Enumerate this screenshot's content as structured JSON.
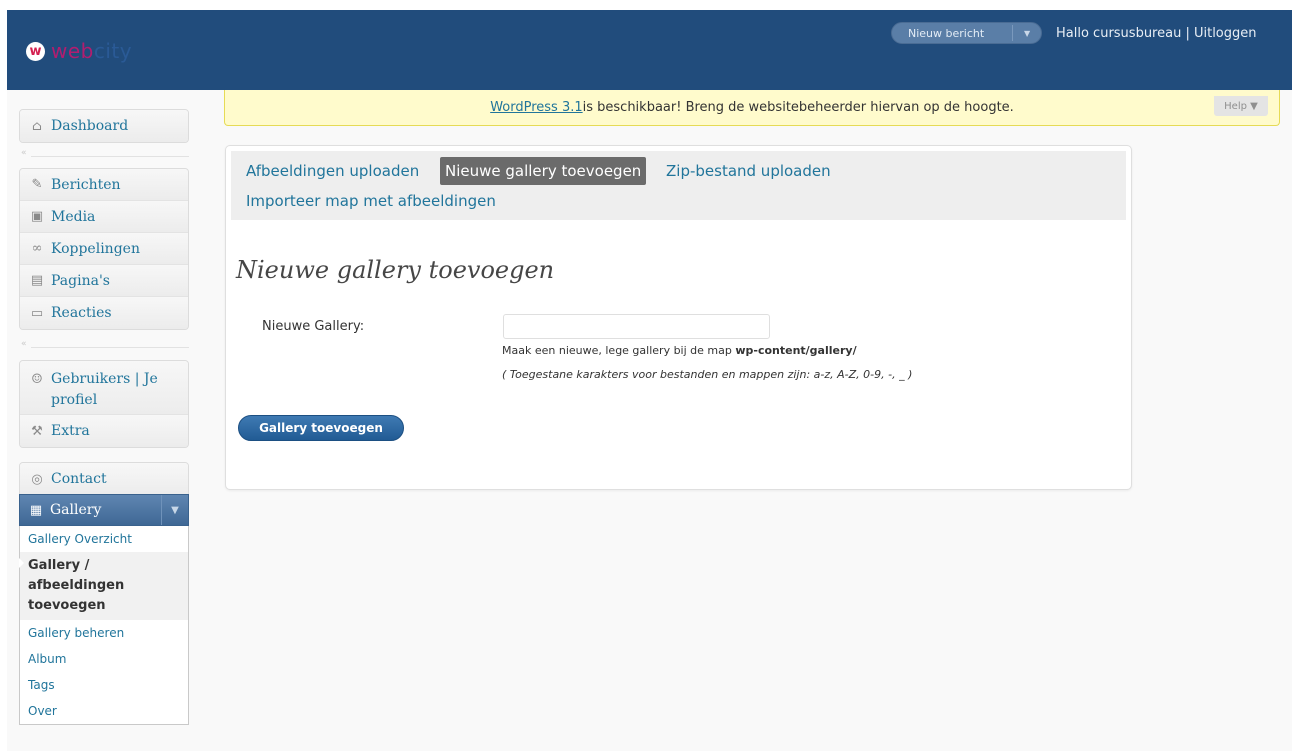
{
  "header": {
    "logo_mark": "w",
    "logo_text_a": "web",
    "logo_text_b": "city",
    "new_post_label": "Nieuw bericht",
    "greeting": "Hallo cursusbureau | Uitloggen"
  },
  "notice": {
    "link_text": "WordPress 3.1",
    "text": " is beschikbaar! Breng de websitebeheerder hiervan op de hoogte.",
    "help_label": "Help"
  },
  "sidebar": {
    "group1": [
      {
        "label": "Dashboard",
        "icon": "dashboard-icon"
      }
    ],
    "group2": [
      {
        "label": "Berichten",
        "icon": "pin-icon"
      },
      {
        "label": "Media",
        "icon": "media-icon"
      },
      {
        "label": "Koppelingen",
        "icon": "link-icon"
      },
      {
        "label": "Pagina's",
        "icon": "pages-icon"
      },
      {
        "label": "Reacties",
        "icon": "comments-icon"
      }
    ],
    "group3": [
      {
        "label": "Gebruikers | Je profiel",
        "icon": "users-icon"
      },
      {
        "label": "Extra",
        "icon": "tools-icon"
      }
    ],
    "group4": [
      {
        "label": "Contact",
        "icon": "contact-icon"
      }
    ],
    "gallery": {
      "label": "Gallery",
      "submenu": [
        "Gallery Overzicht",
        "Gallery / afbeeldingen toevoegen",
        "Gallery beheren",
        "Album",
        "Tags",
        "Over"
      ]
    }
  },
  "main": {
    "tabs": [
      "Afbeeldingen uploaden",
      "Nieuwe gallery toevoegen",
      "Zip-bestand uploaden",
      "Importeer map met afbeeldingen"
    ],
    "title": "Nieuwe gallery toevoegen",
    "field_label": "Nieuwe Gallery:",
    "field_value": "",
    "desc_prefix": "Maak een nieuwe, lege gallery bij de map ",
    "desc_path": "wp-content/gallery/",
    "note": "( Toegestane karakters voor bestanden en mappen zijn: a-z, A-Z, 0-9, -, _ )",
    "button_label": "Gallery toevoegen"
  },
  "colors": {
    "header_bg": "#214c7c",
    "link": "#21759b",
    "notice_bg": "#fffbcc",
    "active_menu": "#3f6895"
  }
}
